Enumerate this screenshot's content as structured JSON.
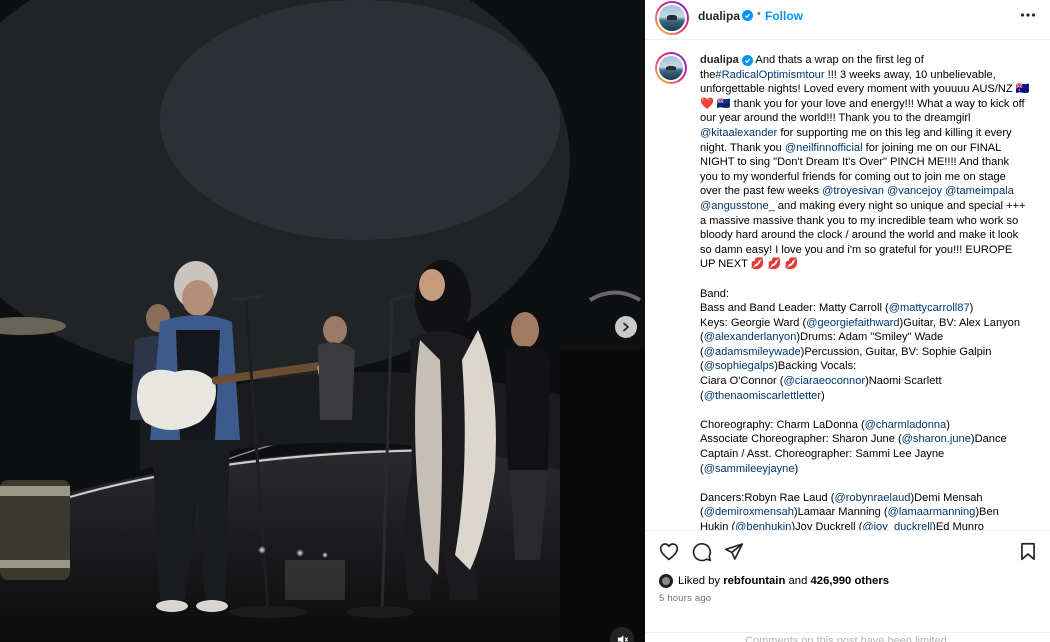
{
  "post": {
    "username": "dualipa",
    "follow_label": "Follow",
    "separator": "•",
    "caption_parts": [
      {
        "t": "text",
        "v": "And thats a wrap on the first leg of the"
      },
      {
        "t": "tag",
        "v": "#RadicalOptimismtour"
      },
      {
        "t": "text",
        "v": " !!! 3 weeks away, 10 unbelievable, unforgettable nights! Loved every moment with youuuu AUS/NZ 🇦🇺 ❤️ 🇳🇿 thank you for your love and energy!!! What a way to kick off our year around the world!!! Thank you to the dreamgirl "
      },
      {
        "t": "tag",
        "v": "@kitaalexander"
      },
      {
        "t": "text",
        "v": " for supporting me on this leg and killing it every night. Thank you "
      },
      {
        "t": "tag",
        "v": "@neilfinnofficial"
      },
      {
        "t": "text",
        "v": " for joining me on our FINAL NIGHT to sing \"Don't Dream It's Over\" PINCH ME!!!! And thank you to my wonderful friends for coming out to join me on stage over the past few weeks "
      },
      {
        "t": "tag",
        "v": "@troyesivan"
      },
      {
        "t": "text",
        "v": " "
      },
      {
        "t": "tag",
        "v": "@vancejoy"
      },
      {
        "t": "text",
        "v": " "
      },
      {
        "t": "tag",
        "v": "@tameimpala"
      },
      {
        "t": "text",
        "v": " "
      },
      {
        "t": "tag",
        "v": "@angusstone_"
      },
      {
        "t": "text",
        "v": " and making every night so unique and special +++ a massive massive thank you to my incredible team who work so bloody hard around the clock / around the world and make it look so damn easy! I love you and i'm so grateful for you!!! EUROPE UP NEXT 💋 💋 💋\n\nBand:\nBass and Band Leader: Matty Carroll ("
      },
      {
        "t": "tag",
        "v": "@mattycarroll87"
      },
      {
        "t": "text",
        "v": ")\nKeys: Georgie Ward ("
      },
      {
        "t": "tag",
        "v": "@georgiefaithward"
      },
      {
        "t": "text",
        "v": ")Guitar, BV: Alex Lanyon ("
      },
      {
        "t": "tag",
        "v": "@alexanderlanyon"
      },
      {
        "t": "text",
        "v": ")Drums: Adam \"Smiley\" Wade ("
      },
      {
        "t": "tag",
        "v": "@adamsmileywade"
      },
      {
        "t": "text",
        "v": ")Percussion, Guitar, BV: Sophie Galpin ("
      },
      {
        "t": "tag",
        "v": "@sophiegalps"
      },
      {
        "t": "text",
        "v": ")Backing Vocals:\nCiara O'Connor ("
      },
      {
        "t": "tag",
        "v": "@ciaraeoconnor"
      },
      {
        "t": "text",
        "v": ")Naomi Scarlett ("
      },
      {
        "t": "tag",
        "v": "@thenaomiscarlettletter"
      },
      {
        "t": "text",
        "v": ")\n\nChoreography: Charm LaDonna ("
      },
      {
        "t": "tag",
        "v": "@charmladonna"
      },
      {
        "t": "text",
        "v": ")\nAssociate Choreographer: Sharon June ("
      },
      {
        "t": "tag",
        "v": "@sharon.june"
      },
      {
        "t": "text",
        "v": ")Dance Captain / Asst. Choreographer: Sammi Lee Jayne ("
      },
      {
        "t": "tag",
        "v": "@sammileeyjayne"
      },
      {
        "t": "text",
        "v": ")\n\nDancers:Robyn Rae Laud ("
      },
      {
        "t": "tag",
        "v": "@robynraelaud"
      },
      {
        "t": "text",
        "v": ")Demi Mensah ("
      },
      {
        "t": "tag",
        "v": "@demiroxmensah"
      },
      {
        "t": "text",
        "v": ")Lamaar Manning ("
      },
      {
        "t": "tag",
        "v": "@lamaarmanning"
      },
      {
        "t": "text",
        "v": ")Ben Hukin ("
      },
      {
        "t": "tag",
        "v": "@benhukin"
      },
      {
        "t": "text",
        "v": ")Joy Duckrell ("
      },
      {
        "t": "tag",
        "v": "@joy_duckrell"
      },
      {
        "t": "text",
        "v": ")Ed Munro"
      }
    ],
    "likes": {
      "prefix": "Liked by",
      "user": "rebfountain",
      "and": "and",
      "count_text": "426,990 others"
    },
    "timestamp": "5 hours ago",
    "comments_limited": "Comments on this post have been limited."
  },
  "colors": {
    "accent": "#0095f6",
    "link": "#00376b",
    "muted": "#737373"
  },
  "icons": [
    "verified-badge-icon",
    "more-options-icon",
    "heart-icon",
    "comment-icon",
    "share-icon",
    "bookmark-icon",
    "next-slide-icon",
    "mute-icon"
  ]
}
